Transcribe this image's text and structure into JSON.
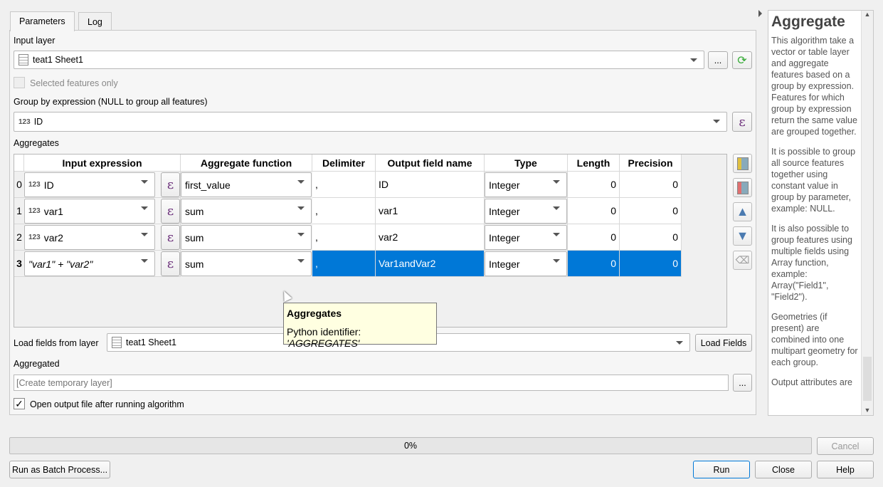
{
  "tabs": [
    {
      "label": "Parameters",
      "active": true
    },
    {
      "label": "Log",
      "active": false
    }
  ],
  "input_layer": {
    "label": "Input layer",
    "value": "teat1 Sheet1",
    "browse_label": "..."
  },
  "selected_only": {
    "label": "Selected features only",
    "checked": false,
    "enabled": false
  },
  "group_by": {
    "label": "Group by expression (NULL to group all features)",
    "type_badge": "123",
    "value": "ID"
  },
  "aggregates": {
    "label": "Aggregates",
    "columns": [
      "Input expression",
      "Aggregate function",
      "Delimiter",
      "Output field name",
      "Type",
      "Length",
      "Precision"
    ],
    "rows": [
      {
        "index": "0",
        "badge": "123",
        "expression": "ID",
        "function": "first_value",
        "delimiter": ",",
        "output": "ID",
        "type": "Integer",
        "length": "0",
        "precision": "0",
        "selected": false
      },
      {
        "index": "1",
        "badge": "123",
        "expression": "var1",
        "function": "sum",
        "delimiter": ",",
        "output": "var1",
        "type": "Integer",
        "length": "0",
        "precision": "0",
        "selected": false
      },
      {
        "index": "2",
        "badge": "123",
        "expression": "var2",
        "function": "sum",
        "delimiter": ",",
        "output": "var2",
        "type": "Integer",
        "length": "0",
        "precision": "0",
        "selected": false
      },
      {
        "index": "3",
        "badge": "",
        "expression": "\"var1\"  +  \"var2\"",
        "function": "sum",
        "delimiter": ",",
        "output": "Var1andVar2",
        "type": "Integer",
        "length": "0",
        "precision": "0",
        "selected": true
      }
    ]
  },
  "tooltip": {
    "title": "Aggregates",
    "prefix": "Python identifier: ",
    "identifier": "'AGGREGATES'"
  },
  "load_fields": {
    "label": "Load fields from layer",
    "value": "teat1 Sheet1",
    "button": "Load Fields"
  },
  "aggregated": {
    "label": "Aggregated",
    "placeholder": "[Create temporary layer]",
    "browse_label": "..."
  },
  "open_output": {
    "label": "Open output file after running algorithm",
    "checked": true
  },
  "help": {
    "title": "Aggregate",
    "paragraphs": [
      "This algorithm take a vector or table layer and aggregate features based on a group by expression. Features for which group by expression return the same value are grouped together.",
      "It is possible to group all source features together using constant value in group by parameter, example: NULL.",
      "It is also possible to group features using multiple fields using Array function, example: Array(\"Field1\", \"Field2\").",
      "Geometries (if present) are combined into one multipart geometry for each group.",
      "Output attributes are"
    ]
  },
  "progress": {
    "value": 0,
    "text": "0%"
  },
  "buttons": {
    "cancel": "Cancel",
    "batch": "Run as Batch Process...",
    "run": "Run",
    "close": "Close",
    "help": "Help"
  },
  "colors": {
    "selection": "#0078d7",
    "expression_icon": "#6b2f7a"
  }
}
